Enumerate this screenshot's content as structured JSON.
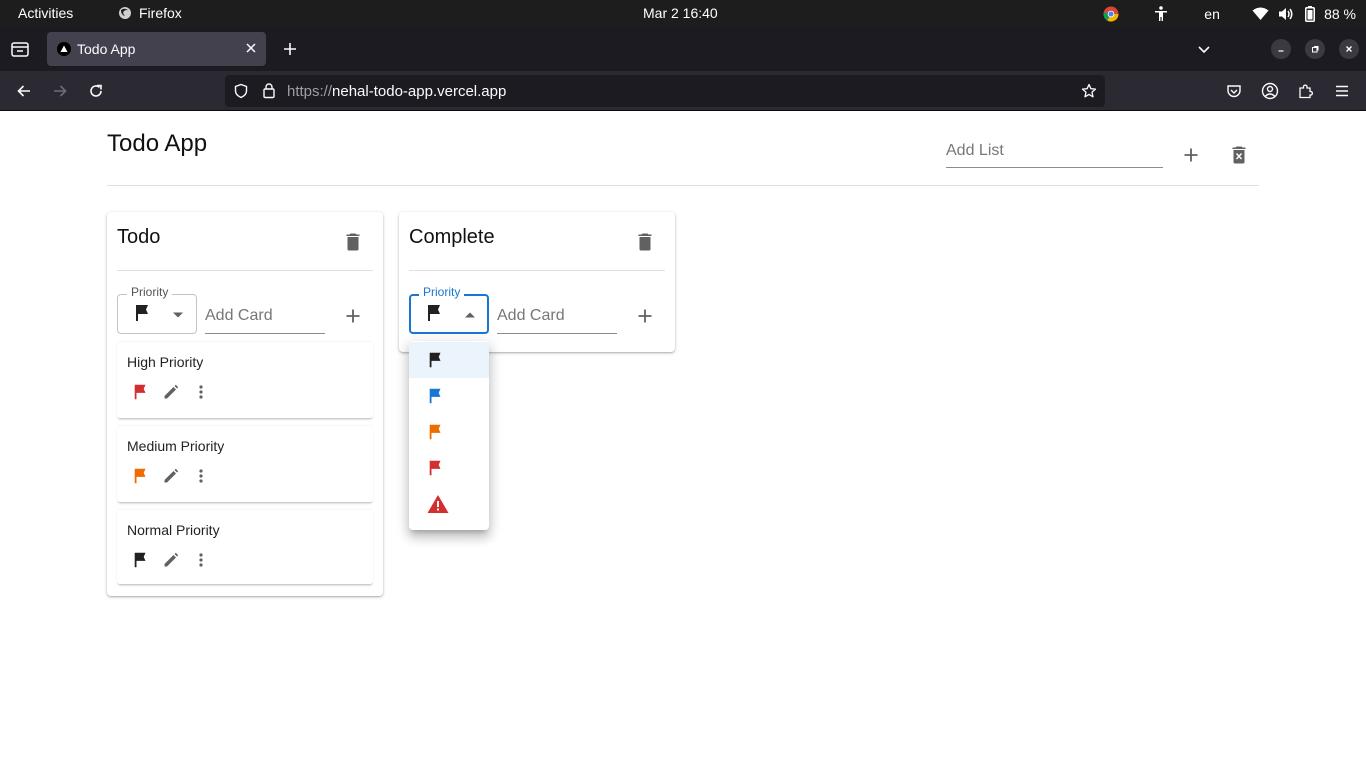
{
  "topbar": {
    "activities": "Activities",
    "app_name": "Firefox",
    "clock": "Mar 2  16:40",
    "language": "en",
    "battery": "88 %"
  },
  "browser": {
    "tab_title": "Todo App",
    "url_scheme": "https://",
    "url_host": "nehal-todo-app.vercel.app"
  },
  "app": {
    "title": "Todo App",
    "add_list_placeholder": "Add List",
    "lists": [
      {
        "title": "Todo",
        "priority_label": "Priority",
        "add_card_placeholder": "Add Card",
        "cards": [
          {
            "title": "High Priority",
            "flag_color": "#d32f2f"
          },
          {
            "title": "Medium Priority",
            "flag_color": "#ef6c00"
          },
          {
            "title": "Normal Priority",
            "flag_color": "#212121"
          }
        ]
      },
      {
        "title": "Complete",
        "priority_label": "Priority",
        "add_card_placeholder": "Add Card",
        "cards": []
      }
    ],
    "priority_options": [
      {
        "icon": "flag-icon",
        "color": "#212121",
        "selected": true
      },
      {
        "icon": "flag-icon",
        "color": "#1976d2"
      },
      {
        "icon": "flag-icon",
        "color": "#ef6c00"
      },
      {
        "icon": "flag-icon",
        "color": "#d32f2f"
      },
      {
        "icon": "warning-icon",
        "color": "#d32f2f"
      }
    ]
  },
  "colors": {
    "accent": "#1976d2",
    "icon_gray": "#616161"
  }
}
